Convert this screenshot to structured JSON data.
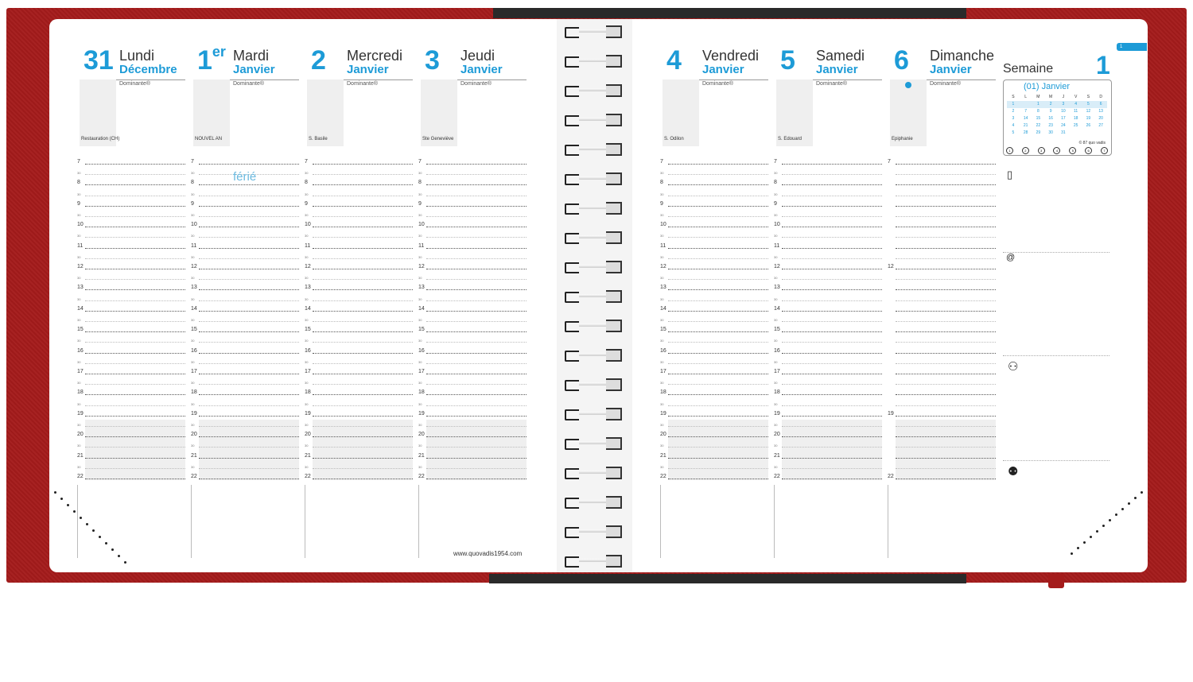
{
  "days": [
    {
      "num": "31",
      "sup": "",
      "name": "Lundi",
      "month": "Décembre",
      "dominante": "Dominante®",
      "saint": "Restauration (CH)",
      "ferie": ""
    },
    {
      "num": "1",
      "sup": "er",
      "name": "Mardi",
      "month": "Janvier",
      "dominante": "Dominante®",
      "saint": "NOUVEL AN",
      "ferie": "férié"
    },
    {
      "num": "2",
      "sup": "",
      "name": "Mercredi",
      "month": "Janvier",
      "dominante": "Dominante®",
      "saint": "S. Basile",
      "ferie": ""
    },
    {
      "num": "3",
      "sup": "",
      "name": "Jeudi",
      "month": "Janvier",
      "dominante": "Dominante®",
      "saint": "Ste Geneviève",
      "ferie": ""
    },
    {
      "num": "4",
      "sup": "",
      "name": "Vendredi",
      "month": "Janvier",
      "dominante": "Dominante®",
      "saint": "S. Odilon",
      "ferie": ""
    },
    {
      "num": "5",
      "sup": "",
      "name": "Samedi",
      "month": "Janvier",
      "dominante": "Dominante®",
      "saint": "S. Edouard",
      "ferie": ""
    },
    {
      "num": "6",
      "sup": "",
      "name": "Dimanche",
      "month": "Janvier",
      "dominante": "Dominante®",
      "saint": "Epiphanie",
      "ferie": ""
    }
  ],
  "hours": [
    "7",
    "8",
    "9",
    "10",
    "11",
    "12",
    "13",
    "14",
    "15",
    "16",
    "17",
    "18",
    "19",
    "20",
    "21",
    "22"
  ],
  "half_label": "30",
  "sunday_hours": [
    "7",
    "12",
    "19",
    "22"
  ],
  "week": {
    "label": "Semaine",
    "number": "1",
    "tab": "1"
  },
  "mini_calendar": {
    "title": "(01) Janvier",
    "headers": [
      "S",
      "L",
      "M",
      "M",
      "J",
      "V",
      "S",
      "D"
    ],
    "rows": [
      [
        "1",
        "",
        "1",
        "2",
        "3",
        "4",
        "5",
        "6"
      ],
      [
        "2",
        "7",
        "8",
        "9",
        "10",
        "11",
        "12",
        "13"
      ],
      [
        "3",
        "14",
        "15",
        "16",
        "17",
        "18",
        "19",
        "20"
      ],
      [
        "4",
        "21",
        "22",
        "23",
        "24",
        "25",
        "26",
        "27"
      ],
      [
        "5",
        "28",
        "29",
        "30",
        "31",
        "",
        "",
        ""
      ]
    ],
    "footer": "© 87 quo vadis",
    "circles": [
      "1",
      "2",
      "3",
      "4",
      "5",
      "6",
      "7"
    ]
  },
  "icons": [
    "mobile-phone-icon",
    "at-sign-icon",
    "couple-icon",
    "family-icon"
  ],
  "icon_glyphs": {
    "phone": "▯",
    "at": "@",
    "couple": "⚇",
    "family": "⚉"
  },
  "url": "www.quovadis1954.com",
  "colors": {
    "cover": "#a41b1b",
    "accent": "#1d9bd7",
    "band": "#2a2a2a"
  }
}
